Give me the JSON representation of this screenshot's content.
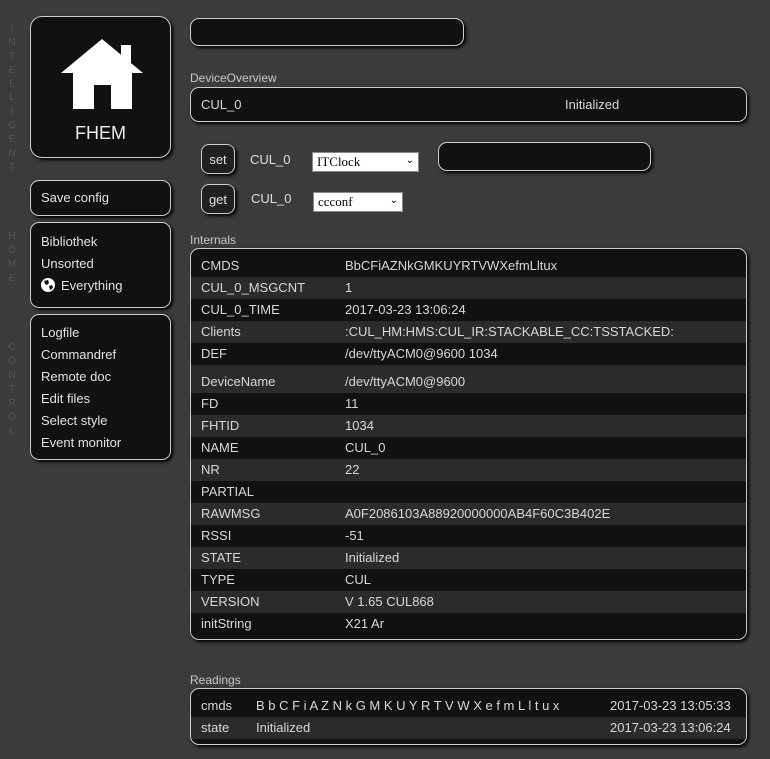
{
  "sidebar_vertical_text": [
    "I",
    "N",
    "T",
    "E",
    "L",
    "L",
    "I",
    "G",
    "E",
    "N",
    "T",
    "",
    "",
    "",
    "",
    "H",
    "O",
    "M",
    "E",
    "",
    "",
    "",
    "",
    "C",
    "O",
    "N",
    "T",
    "R",
    "O",
    "L"
  ],
  "logo": {
    "text": "FHEM"
  },
  "menu": {
    "save_config": "Save config",
    "rooms": [
      "Bibliothek",
      "Unsorted",
      "Everything"
    ],
    "tools": [
      "Logfile",
      "Commandref",
      "Remote doc",
      "Edit files",
      "Select style",
      "Event monitor"
    ]
  },
  "search": {
    "value": ""
  },
  "overview": {
    "label": "DeviceOverview",
    "device": "CUL_0",
    "state": "Initialized"
  },
  "commands": {
    "set_label": "set",
    "set_device": "CUL_0",
    "set_option": "ITClock",
    "set_value": "",
    "get_label": "get",
    "get_device": "CUL_0",
    "get_option": "ccconf"
  },
  "internals": {
    "label": "Internals",
    "rows": [
      {
        "name": "CMDS",
        "value": "BbCFiAZNkGMKUYRTVWXefmLltux"
      },
      {
        "name": "CUL_0_MSGCNT",
        "value": "1"
      },
      {
        "name": "CUL_0_TIME",
        "value": "2017-03-23 13:06:24"
      },
      {
        "name": "Clients",
        "value": ":CUL_HM:HMS:CUL_IR:STACKABLE_CC:TSSTACKED:"
      },
      {
        "name": "DEF",
        "value": "/dev/ttyACM0@9600 1034"
      },
      {
        "name": "DeviceName",
        "value": "/dev/ttyACM0@9600"
      },
      {
        "name": "FD",
        "value": "11"
      },
      {
        "name": "FHTID",
        "value": "1034"
      },
      {
        "name": "NAME",
        "value": "CUL_0"
      },
      {
        "name": "NR",
        "value": "22"
      },
      {
        "name": "PARTIAL",
        "value": ""
      },
      {
        "name": "RAWMSG",
        "value": "A0F2086103A88920000000AB4F60C3B402E"
      },
      {
        "name": "RSSI",
        "value": "-51"
      },
      {
        "name": "STATE",
        "value": "Initialized"
      },
      {
        "name": "TYPE",
        "value": "CUL"
      },
      {
        "name": "VERSION",
        "value": "V 1.65 CUL868"
      },
      {
        "name": "initString",
        "value": "X21 Ar"
      }
    ]
  },
  "readings": {
    "label": "Readings",
    "rows": [
      {
        "name": "cmds",
        "value": "B b C F i A Z N k G M K U Y R T V W X e f m L l t u x",
        "time": "2017-03-23 13:05:33"
      },
      {
        "name": "state",
        "value": "Initialized",
        "time": "2017-03-23 13:06:24"
      }
    ]
  }
}
